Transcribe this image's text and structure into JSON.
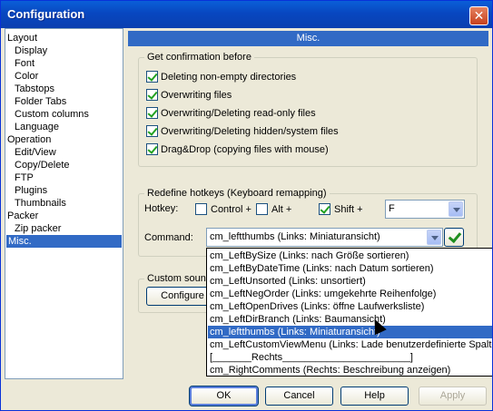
{
  "window": {
    "title": "Configuration",
    "close_label": "✕"
  },
  "tree": {
    "items": [
      {
        "label": "Layout",
        "level": 0
      },
      {
        "label": "Display",
        "level": 1
      },
      {
        "label": "Font",
        "level": 1
      },
      {
        "label": "Color",
        "level": 1
      },
      {
        "label": "Tabstops",
        "level": 1
      },
      {
        "label": "Folder Tabs",
        "level": 1
      },
      {
        "label": "Custom columns",
        "level": 1
      },
      {
        "label": "Language",
        "level": 1
      },
      {
        "label": "Operation",
        "level": 0
      },
      {
        "label": "Edit/View",
        "level": 1
      },
      {
        "label": "Copy/Delete",
        "level": 1
      },
      {
        "label": "FTP",
        "level": 1
      },
      {
        "label": "Plugins",
        "level": 1
      },
      {
        "label": "Thumbnails",
        "level": 1
      },
      {
        "label": "Packer",
        "level": 0
      },
      {
        "label": "Zip packer",
        "level": 1
      },
      {
        "label": "Misc.",
        "level": 0,
        "selected": true
      }
    ]
  },
  "panel": {
    "title": "Misc."
  },
  "confirm_group": {
    "title": "Get confirmation before",
    "options": [
      {
        "label": "Deleting non-empty directories",
        "checked": true
      },
      {
        "label": "Overwriting files",
        "checked": true
      },
      {
        "label": "Overwriting/Deleting read-only files",
        "checked": true
      },
      {
        "label": "Overwriting/Deleting hidden/system files",
        "checked": true
      },
      {
        "label": "Drag&Drop (copying files with mouse)",
        "checked": true
      }
    ]
  },
  "hotkey_group": {
    "title": "Redefine hotkeys (Keyboard remapping)",
    "hotkey_label": "Hotkey:",
    "control_label": "Control +",
    "control_checked": false,
    "alt_label": "Alt +",
    "alt_checked": false,
    "shift_label": "Shift +",
    "shift_checked": true,
    "key_value": "F",
    "command_label": "Command:",
    "command_value": "cm_leftthumbs (Links: Miniaturansicht)"
  },
  "sound_group": {
    "title": "Custom sound",
    "configure_label": "Configure"
  },
  "dropdown_items": [
    {
      "label": "cm_LeftBySize (Links: nach Größe sortieren)"
    },
    {
      "label": "cm_LeftByDateTime (Links: nach Datum sortieren)"
    },
    {
      "label": "cm_LeftUnsorted (Links: unsortiert)"
    },
    {
      "label": "cm_LeftNegOrder (Links: umgekehrte Reihenfolge)"
    },
    {
      "label": "cm_LeftOpenDrives (Links: öffne Laufwerksliste)"
    },
    {
      "label": "cm_LeftDirBranch (Links: Baumansicht)"
    },
    {
      "label": "cm_leftthumbs (Links: Miniaturansicht)",
      "selected": true
    },
    {
      "label": "cm_LeftCustomViewMenu (Links:  Lade benutzerdefinierte Spalte"
    },
    {
      "label": "[_______Rechts_______________________]"
    },
    {
      "label": "cm_RightComments (Rechts: Beschreibung anzeigen)"
    }
  ],
  "buttons": {
    "ok": "OK",
    "cancel": "Cancel",
    "help": "Help",
    "apply": "Apply"
  }
}
